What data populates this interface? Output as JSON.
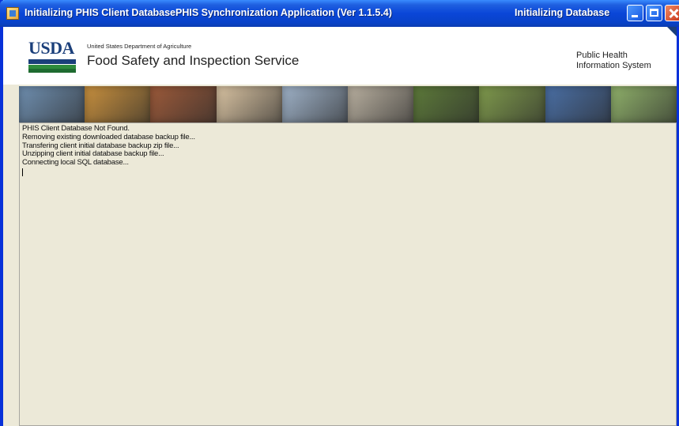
{
  "window": {
    "title": "Initializing PHIS Client DatabasePHIS Synchronization Application (Ver 1.1.5.4)",
    "status_title": "Initializing Database",
    "colors": {
      "titlebar": "#0a46d8",
      "face": "#ece9d8",
      "close": "#c8361a"
    }
  },
  "banner": {
    "logo_text": "USDA",
    "department": "United States Department of Agriculture",
    "agency": "Food Safety and Inspection Service",
    "system_line1": "Public Health",
    "system_line2": "Information System"
  },
  "photo_strip": [
    {
      "name": "inspectors-photo",
      "color": "#6f8fb0"
    },
    {
      "name": "bread-photo",
      "color": "#c8903e"
    },
    {
      "name": "meat-processing-photo",
      "color": "#9c5a3a"
    },
    {
      "name": "poultry-photo",
      "color": "#d9c3a2"
    },
    {
      "name": "lab-photo",
      "color": "#9fb2c8"
    },
    {
      "name": "kitchen-staff-photo",
      "color": "#b9b0a0"
    },
    {
      "name": "cattle-photo",
      "color": "#5d7a3a"
    },
    {
      "name": "crop-field-photo",
      "color": "#7f9a4c"
    },
    {
      "name": "scientist-photo",
      "color": "#4a6fa5"
    },
    {
      "name": "field-workers-photo",
      "color": "#8fb06a"
    }
  ],
  "log": {
    "lines": [
      "PHIS Client Database Not Found.",
      "Removing existing downloaded database backup file...",
      "Transfering client initial database backup zip file...",
      "Unzipping client initial database backup file...",
      "Connecting local SQL database..."
    ]
  }
}
